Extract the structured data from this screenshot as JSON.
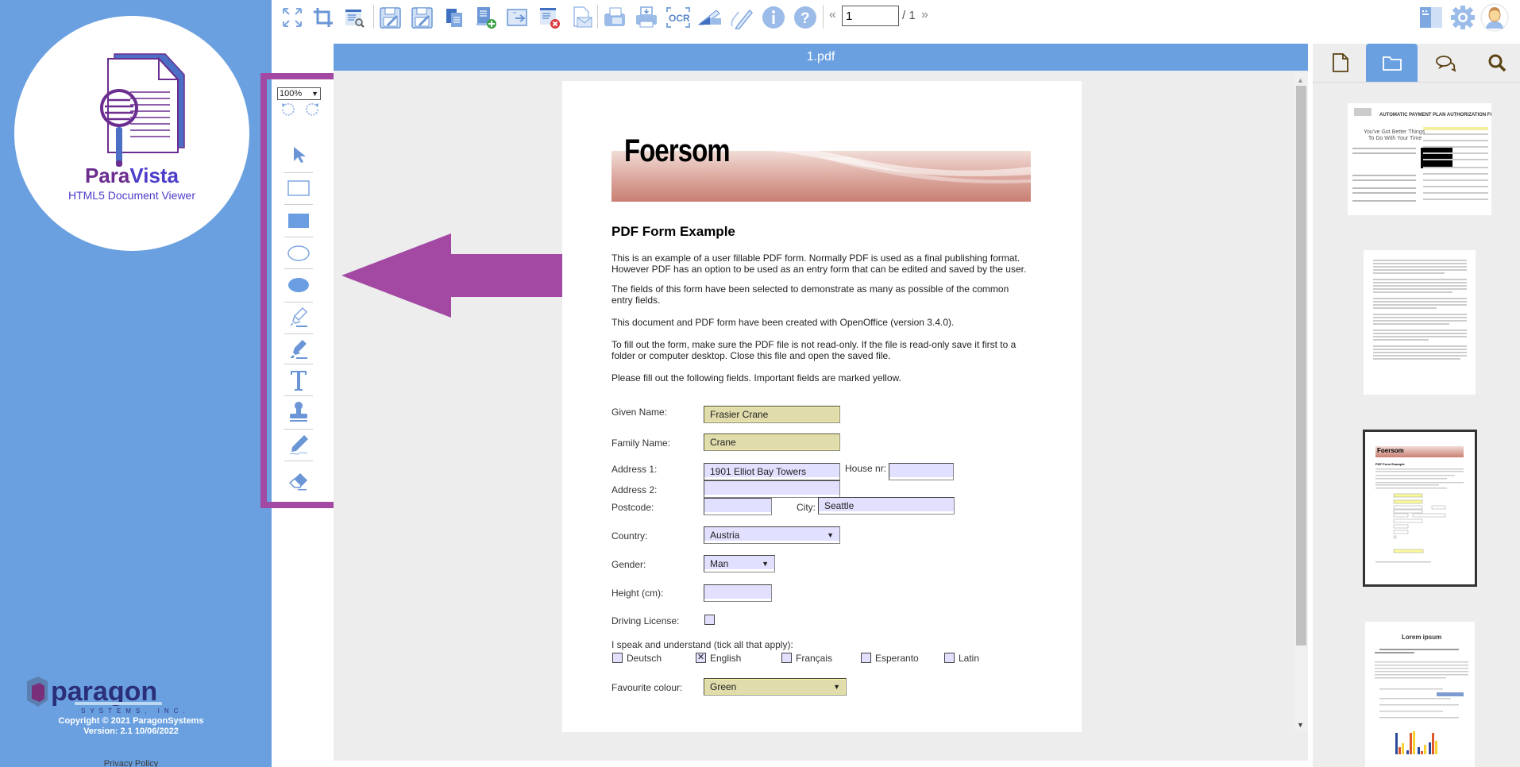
{
  "brand": {
    "name_part1": "Para",
    "name_part2": "Vista",
    "subtitle": "HTML5 Document Viewer",
    "company": "paragon",
    "company_sub": "SYSTEMS, INC.",
    "copyright": "Copyright © 2021 ParagonSystems",
    "version": "Version: 2.1 10/06/2022",
    "privacy_link": "Privacy Policy",
    "colors": {
      "sidebar": "#6aa0e0",
      "purple": "#6b2d8f",
      "indigo": "#4b3cc9",
      "annotation": "#a349a4"
    }
  },
  "toolbar": {
    "icons": [
      "fit-screen-icon",
      "crop-icon",
      "view-search-icon",
      "save-edit-icon",
      "save-as-icon",
      "copy-pages-icon",
      "add-page-icon",
      "export-icon",
      "delete-page-icon",
      "email-icon",
      "fax-icon",
      "print-icon",
      "ocr-icon",
      "scan-icon",
      "signature-icon",
      "info-icon",
      "help-icon"
    ],
    "page_prev": "«",
    "page_input": "1",
    "page_total": "/ 1",
    "page_next": "»",
    "right_icons": [
      "panel-toggle-icon",
      "settings-gear-icon",
      "user-avatar-icon"
    ]
  },
  "annotation_tools": {
    "zoom_value": "100%",
    "items": [
      "select-arrow-icon",
      "rectangle-outline-icon",
      "rectangle-filled-icon",
      "ellipse-outline-icon",
      "ellipse-filled-icon",
      "highlighter-outline-icon",
      "highlighter-filled-icon",
      "text-icon",
      "stamp-icon",
      "freehand-pen-icon",
      "eraser-icon"
    ]
  },
  "document": {
    "title": "1.pdf",
    "banner_title": "Foersom",
    "heading": "PDF Form Example",
    "paragraphs": [
      "This is an example of a user fillable PDF form. Normally PDF is used as a final publishing format. However PDF has an option to be used as an entry form that can be edited and saved by the user.",
      "The fields of this form have been selected to demonstrate as many as possible of the common entry fields.",
      "This document and PDF form have been created with OpenOffice (version 3.4.0).",
      "To fill out the form, make sure the PDF file is not read-only. If the file is read-only save it first to a folder or computer desktop. Close this file and open the saved file.",
      "Please fill out the following fields. Important fields are marked yellow."
    ],
    "form": {
      "given_name": {
        "label": "Given Name:",
        "value": "Frasier Crane"
      },
      "family_name": {
        "label": "Family Name:",
        "value": "Crane"
      },
      "address1": {
        "label": "Address 1:",
        "value": "1901 Elliot Bay Towers"
      },
      "house_nr": {
        "label": "House nr:",
        "value": ""
      },
      "address2": {
        "label": "Address 2:",
        "value": ""
      },
      "postcode": {
        "label": "Postcode:",
        "value": ""
      },
      "city": {
        "label": "City:",
        "value": "Seattle"
      },
      "country": {
        "label": "Country:",
        "value": "Austria"
      },
      "gender": {
        "label": "Gender:",
        "value": "Man"
      },
      "height": {
        "label": "Height (cm):",
        "value": ""
      },
      "driving_license": {
        "label": "Driving License:",
        "checked": false
      },
      "languages_label": "I speak and understand (tick all that apply):",
      "languages": [
        {
          "label": "Deutsch",
          "checked": false,
          "mark": ""
        },
        {
          "label": "English",
          "checked": true,
          "mark": "✕"
        },
        {
          "label": "Français",
          "checked": false,
          "mark": ""
        },
        {
          "label": "Esperanto",
          "checked": false,
          "mark": ""
        },
        {
          "label": "Latin",
          "checked": false,
          "mark": ""
        }
      ],
      "favourite_colour": {
        "label": "Favourite colour:",
        "value": "Green"
      }
    }
  },
  "right_panel": {
    "tabs": [
      "page-view-icon",
      "folder-icon",
      "comments-icon",
      "search-icon"
    ],
    "active_tab": "folder-icon",
    "thumbnails": [
      {
        "label": "Automatic Payment Plan Authorization Form",
        "selected": false
      },
      {
        "label": "Text page",
        "selected": false
      },
      {
        "label": "PDF Form Example",
        "selected": true
      },
      {
        "label": "Lorem ipsum",
        "selected": false
      }
    ]
  }
}
